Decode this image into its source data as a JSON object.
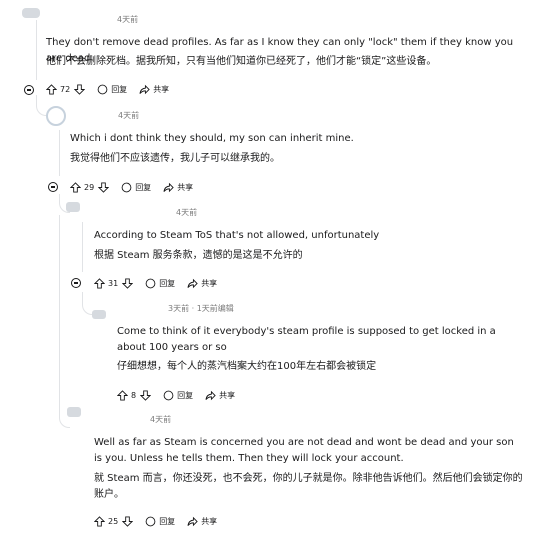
{
  "comments": [
    {
      "time": "4天前",
      "text_en": "They don't remove dead profiles. As far as I know they can only \"lock\" them if they know you are dead.",
      "text_zh": "他们不会删除死档。据我所知，只有当他们知道你已经死了，他们才能“锁定”这些设备。",
      "votes": "72",
      "reply": "回复",
      "share": "共享"
    },
    {
      "time": "4天前",
      "text_en": "Which i dont think they should, my son can inherit mine.",
      "text_zh": "我觉得他们不应该遗传，我儿子可以继承我的。",
      "votes": "29",
      "reply": "回复",
      "share": "共享"
    },
    {
      "time": "4天前",
      "text_en": "According to Steam ToS that's not allowed, unfortunately",
      "text_zh": "根据 Steam 服务条款，遗憾的是这是不允许的",
      "votes": "31",
      "reply": "回复",
      "share": "共享"
    },
    {
      "time": "3天前 · 1天前编辑",
      "text_en": "Come to think of it everybody's steam profile is supposed to get locked in a about 100 years or so",
      "text_zh": "仔细想想，每个人的蒸汽档案大约在100年左右都会被锁定",
      "votes": "8",
      "reply": "回复",
      "share": "共享"
    },
    {
      "time": "4天前",
      "text_en": "Well as far as Steam is concerned you are not dead and wont be dead and your son is you. Unless he tells them. Then they will lock your account.",
      "text_zh": "就 Steam 而言，你还没死，也不会死，你的儿子就是你。除非他告诉他们。然后他们会锁定你的账户。",
      "votes": "25",
      "reply": "回复",
      "share": "共享"
    }
  ]
}
